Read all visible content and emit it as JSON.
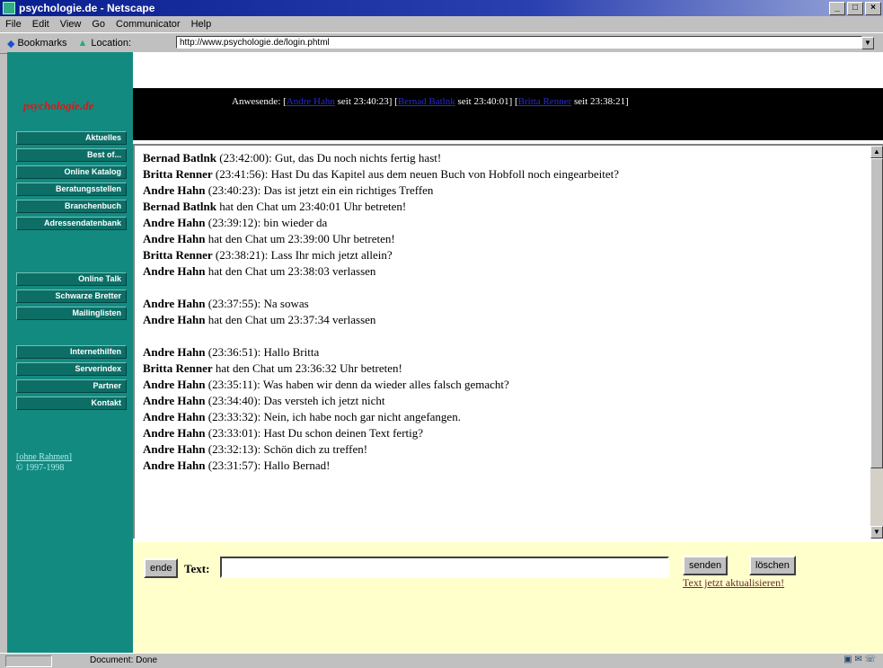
{
  "window": {
    "title": "psychologie.de - Netscape",
    "min": "_",
    "max": "□",
    "close": "×"
  },
  "menu": [
    "File",
    "Edit",
    "View",
    "Go",
    "Communicator",
    "Help"
  ],
  "toolbar": {
    "bookmarks": "Bookmarks",
    "location_label": "Location:",
    "url": "http://www.psychologie.de/login.phtml"
  },
  "sidebar": {
    "logo": "psychologie.de",
    "items": [
      "Aktuelles",
      "Best of...",
      "Online Katalog",
      "Beratungsstellen",
      "Branchenbuch",
      "Adressendatenbank",
      "Online Talk",
      "Schwarze Bretter",
      "Mailinglisten",
      "Internethilfen",
      "Serverindex",
      "Partner",
      "Kontakt"
    ],
    "link": "[ohne Rahmen]",
    "copyright": "© 1997-1998"
  },
  "header": {
    "prefix": "Anwesende: [",
    "users": [
      {
        "name": "Andre Hahn",
        "since": " seit 23:40:23] ["
      },
      {
        "name": "Bernad Batlnk",
        "since": " seit 23:40:01] ["
      },
      {
        "name": "Britta Renner",
        "since": " seit 23:38:21]"
      }
    ]
  },
  "chat": {
    "lines": [
      {
        "name": "Bernad Batlnk",
        "text": " (23:42:00): Gut, das Du noch nichts fertig hast!"
      },
      {
        "name": "Britta Renner",
        "text": " (23:41:56): Hast Du das Kapitel aus dem neuen Buch von Hobfoll noch eingearbeitet?"
      },
      {
        "name": "Andre Hahn",
        "text": " (23:40:23): Das ist jetzt ein ein richtiges Treffen"
      },
      {
        "name": "Bernad Batlnk",
        "text": " hat den Chat um 23:40:01 Uhr betreten!"
      },
      {
        "name": "Andre Hahn",
        "text": " (23:39:12): bin wieder da"
      },
      {
        "name": "Andre Hahn",
        "text": " hat den Chat um 23:39:00 Uhr betreten!"
      },
      {
        "name": "Britta Renner",
        "text": " (23:38:21): Lass Ihr mich jetzt allein?"
      },
      {
        "name": "Andre Hahn",
        "text": " hat den Chat um 23:38:03 verlassen"
      },
      {
        "gap": true
      },
      {
        "name": "Andre Hahn",
        "text": " (23:37:55): Na sowas"
      },
      {
        "name": "Andre Hahn",
        "text": " hat den Chat um 23:37:34 verlassen"
      },
      {
        "gap": true
      },
      {
        "name": "Andre Hahn",
        "text": " (23:36:51): Hallo Britta"
      },
      {
        "name": "Britta Renner",
        "text": " hat den Chat um 23:36:32 Uhr betreten!"
      },
      {
        "name": "Andre Hahn",
        "text": " (23:35:11): Was haben wir denn da wieder alles falsch gemacht?"
      },
      {
        "name": "Andre Hahn",
        "text": " (23:34:40): Das versteh ich jetzt nicht"
      },
      {
        "name": "Andre Hahn",
        "text": " (23:33:32): Nein, ich habe noch gar nicht angefangen."
      },
      {
        "name": "Andre Hahn",
        "text": " (23:33:01): Hast Du schon deinen Text fertig?"
      },
      {
        "name": "Andre Hahn",
        "text": " (23:32:13): Schön dich zu treffen!"
      },
      {
        "name": "Andre Hahn",
        "text": " (23:31:57): Hallo Bernad!"
      }
    ]
  },
  "form": {
    "ende": "ende",
    "text_label": "Text:",
    "text_value": "",
    "senden": "senden",
    "loeschen": "löschen",
    "refresh": "Text jetzt aktualisieren!"
  },
  "status": {
    "text": "Document: Done"
  }
}
